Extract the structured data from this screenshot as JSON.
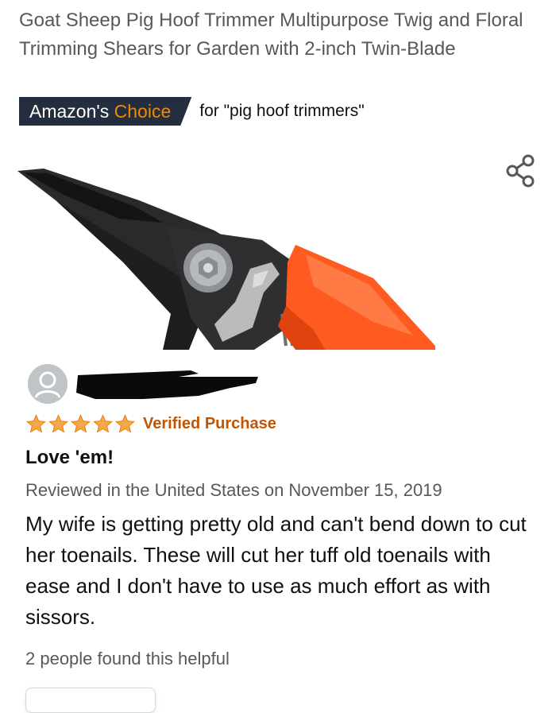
{
  "product": {
    "title": "Goat Sheep Pig Hoof Trimmer Multipurpose Twig and Floral Trimming Shears for Garden with 2-inch Twin-Blade",
    "badge_prefix": "Amazon's",
    "badge_accent": "Choice",
    "badge_query": "for \"pig hoof trimmers\"",
    "image_icon": "pruning-shears-image"
  },
  "icons": {
    "share": "share-icon",
    "avatar": "user-avatar-icon",
    "star": "star-icon"
  },
  "review": {
    "rating": 5,
    "rating_max": 5,
    "verified": "Verified Purchase",
    "title": "Love 'em!",
    "meta": "Reviewed in the United States on November 15, 2019",
    "body": "My wife is getting pretty old and can't bend down to cut her toenails. These will cut her tuff old toenails with ease and I don't have to use as much effort as with sissors.",
    "helpful": "2 people found this helpful"
  },
  "colors": {
    "badge_bg": "#232f3e",
    "badge_accent": "#f08804",
    "star": "#f3a847",
    "verified": "#c45500",
    "muted_text": "#565959",
    "handle_orange": "#ff5a1f"
  }
}
